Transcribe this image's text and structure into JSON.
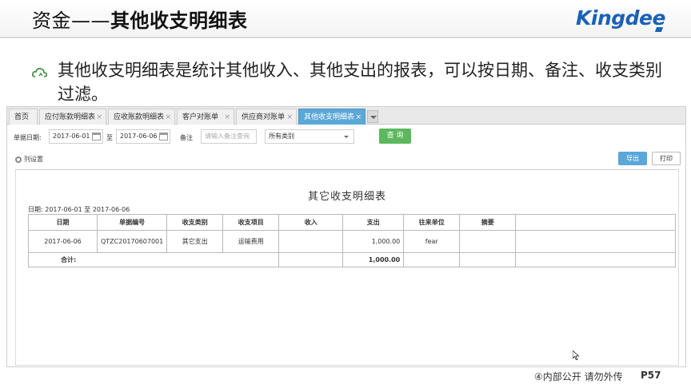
{
  "slide": {
    "title_part1": "资金——",
    "title_part2": "其他收支明细表",
    "logo": "Kingdee",
    "bullet_text": "其他收支明细表是统计其他收入、其他支出的报表，可以按日期、备注、收支类别过滤。",
    "footer": "④内部公开 请勿外传",
    "page": "P57"
  },
  "tabs": [
    {
      "label": "首页",
      "closable": false
    },
    {
      "label": "应付账款明细表",
      "closable": true
    },
    {
      "label": "应收账款明细表",
      "closable": true
    },
    {
      "label": "客户对账单",
      "closable": true
    },
    {
      "label": "供应商对账单",
      "closable": true
    },
    {
      "label": "其他收支明细表",
      "closable": true,
      "active": true
    }
  ],
  "filters": {
    "date_label": "单据日期:",
    "date_from": "2017-06-01",
    "to_label": "至",
    "date_to": "2017-06-06",
    "remark_label": "备注",
    "remark_placeholder": "请输入备注查询",
    "category_value": "所有类别",
    "query_button": "查 询"
  },
  "toolbar": {
    "column_settings": "列设置",
    "export_button": "导出",
    "print_button": "打印"
  },
  "report": {
    "title": "其它收支明细表",
    "date_range": "日期: 2017-06-01 至 2017-06-06",
    "columns": [
      "日期",
      "单据编号",
      "收支类别",
      "收支项目",
      "收入",
      "支出",
      "往来单位",
      "摘要"
    ],
    "rows": [
      {
        "date": "2017-06-06",
        "bill_no": "QTZC20170607001",
        "category": "其它支出",
        "item": "运输费用",
        "income": "",
        "expense": "1,000.00",
        "partner": "fear",
        "summary": ""
      }
    ],
    "total": {
      "label": "合计:",
      "income": "",
      "expense": "1,000.00"
    }
  },
  "colors": {
    "active_tab": "#5aa7d8",
    "query_button": "#5cb85c",
    "logo": "#1a62b5"
  }
}
